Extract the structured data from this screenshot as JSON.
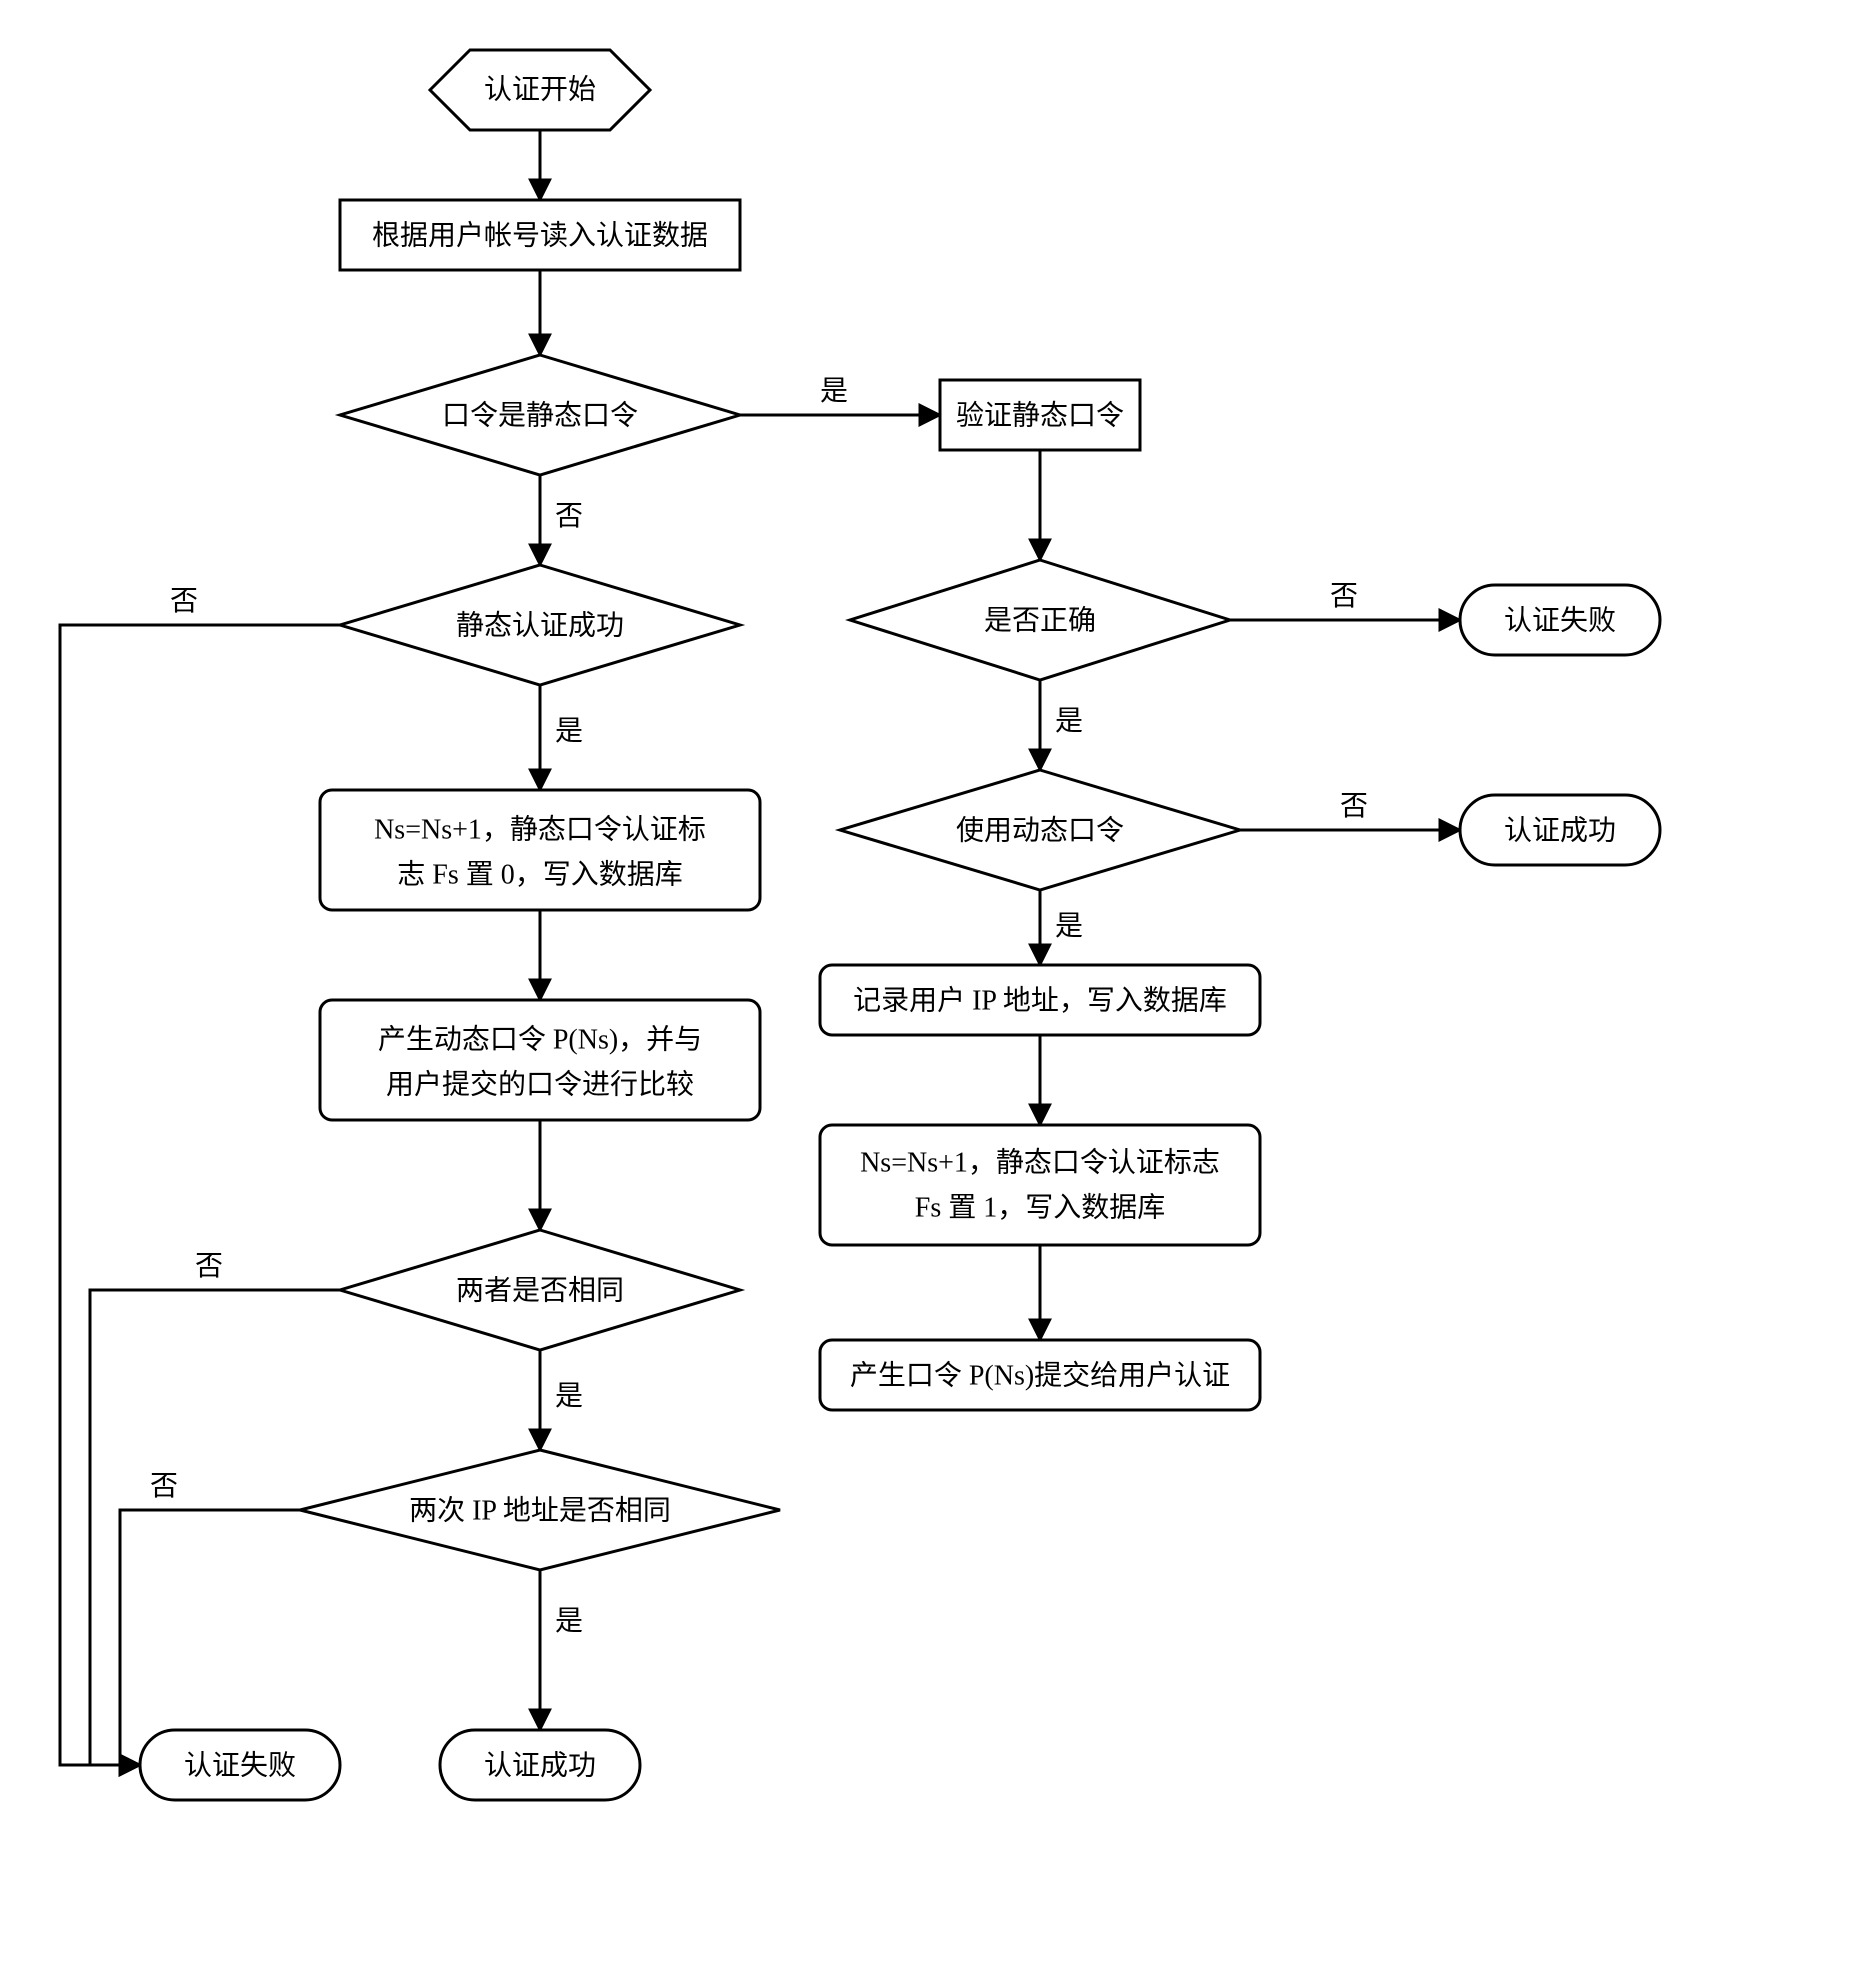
{
  "chart_data": {
    "type": "flowchart",
    "title": "",
    "nodes": [
      {
        "id": "start",
        "shape": "hexagon",
        "text": "认证开始"
      },
      {
        "id": "readData",
        "shape": "process",
        "text": "根据用户帐号读入认证数据"
      },
      {
        "id": "isStaticPwd",
        "shape": "decision",
        "text": "口令是静态口令"
      },
      {
        "id": "verifyStatic",
        "shape": "process",
        "text": "验证静态口令"
      },
      {
        "id": "isCorrect",
        "shape": "decision",
        "text": "是否正确"
      },
      {
        "id": "failTopRight",
        "shape": "terminator",
        "text": "认证失败"
      },
      {
        "id": "useDynamic",
        "shape": "decision",
        "text": "使用动态口令"
      },
      {
        "id": "successRight",
        "shape": "terminator",
        "text": "认证成功"
      },
      {
        "id": "recordIP",
        "shape": "process-round",
        "text": "记录用户 IP 地址，写入数据库"
      },
      {
        "id": "nsFs1",
        "shape": "process-round",
        "text": "Ns=Ns+1，静态口令认证标志  Fs 置 1，写入数据库"
      },
      {
        "id": "genP_toUser",
        "shape": "process-round",
        "text": "产生口令 P(Ns)提交给用户认证"
      },
      {
        "id": "staticAuthOK",
        "shape": "decision",
        "text": "静态认证成功"
      },
      {
        "id": "nsFs0",
        "shape": "process-round",
        "text": "Ns=Ns+1，静态口令认证标志 Fs 置 0，写入数据库"
      },
      {
        "id": "genP_compare",
        "shape": "process-round",
        "text": "产生动态口令 P(Ns)，并与用户提交的口令进行比较"
      },
      {
        "id": "sameBoth",
        "shape": "decision",
        "text": "两者是否相同"
      },
      {
        "id": "sameIP",
        "shape": "decision",
        "text": "两次 IP 地址是否相同"
      },
      {
        "id": "failBottom",
        "shape": "terminator",
        "text": "认证失败"
      },
      {
        "id": "successBottom",
        "shape": "terminator",
        "text": "认证成功"
      }
    ],
    "edges": [
      {
        "from": "start",
        "to": "readData"
      },
      {
        "from": "readData",
        "to": "isStaticPwd"
      },
      {
        "from": "isStaticPwd",
        "to": "verifyStatic",
        "label": "是"
      },
      {
        "from": "isStaticPwd",
        "to": "staticAuthOK",
        "label": "否"
      },
      {
        "from": "verifyStatic",
        "to": "isCorrect"
      },
      {
        "from": "isCorrect",
        "to": "failTopRight",
        "label": "否"
      },
      {
        "from": "isCorrect",
        "to": "useDynamic",
        "label": "是"
      },
      {
        "from": "useDynamic",
        "to": "successRight",
        "label": "否"
      },
      {
        "from": "useDynamic",
        "to": "recordIP",
        "label": "是"
      },
      {
        "from": "recordIP",
        "to": "nsFs1"
      },
      {
        "from": "nsFs1",
        "to": "genP_toUser"
      },
      {
        "from": "staticAuthOK",
        "to": "nsFs0",
        "label": "是"
      },
      {
        "from": "staticAuthOK",
        "to": "failBottom",
        "label": "否"
      },
      {
        "from": "nsFs0",
        "to": "genP_compare"
      },
      {
        "from": "genP_compare",
        "to": "sameBoth"
      },
      {
        "from": "sameBoth",
        "to": "sameIP",
        "label": "是"
      },
      {
        "from": "sameBoth",
        "to": "failBottom",
        "label": "否"
      },
      {
        "from": "sameIP",
        "to": "successBottom",
        "label": "是"
      },
      {
        "from": "sameIP",
        "to": "failBottom",
        "label": "否"
      }
    ]
  },
  "labels": {
    "yes": "是",
    "no": "否"
  }
}
